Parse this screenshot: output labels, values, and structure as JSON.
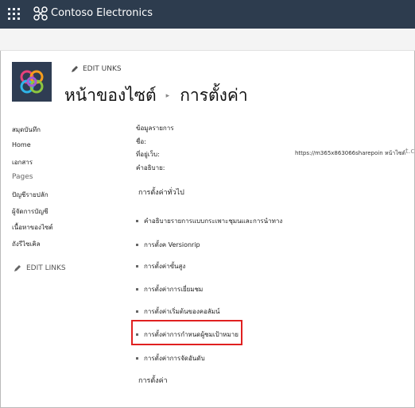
{
  "suite": {
    "app_name": "Contoso Electronics"
  },
  "header": {
    "edit_links_label": "EDIT UNKS",
    "breadcrumb_parent": "หน้าของไซต์",
    "breadcrumb_separator": "▸",
    "page_title": "การตั้งค่า"
  },
  "leftnav": {
    "items": [
      {
        "label": "สมุดบันทึก"
      },
      {
        "label": "Home"
      },
      {
        "label": "เอกสาร"
      },
      {
        "label": "Pages"
      },
      {
        "label": "ปัญชีรายปลัก"
      },
      {
        "label": "ผู้จัดการบัญชี"
      },
      {
        "label": "เนื้อหาของไซต์"
      },
      {
        "label": "ถังรีไซเคิล"
      }
    ],
    "edit_links_label": "EDIT LINKS"
  },
  "site_info": {
    "heading": "ข้อมูลรายการ",
    "name_label": "ชื่อ:",
    "address_label": "ที่อยู่เว็บ:",
    "address_value": "https://m365x863066sharepoin หน้าไซต์",
    "address_trail": "t.c",
    "description_label": "คำอธิบาย:"
  },
  "general_settings": {
    "heading": "การตั้งค่าทั่วไป",
    "items": [
      {
        "label": "คำอธิบายรายการแบบกระเพาะชุมนและการนำทาง"
      },
      {
        "label": "การตั้งค Versionrip"
      },
      {
        "label": "การตั้งค่าขั้นสูง"
      },
      {
        "label": "การตั้งค่าการเยี่ยมชม"
      },
      {
        "label": "การตั้งค่าเริ่มต้นของคอลัมน์"
      },
      {
        "label": "การตั้งค่าการกำหนดผู้ชมเป้าหมาย"
      },
      {
        "label": "การตั้งค่าการจัดอันดับ"
      }
    ],
    "footer_heading": "การตั้งค่า"
  },
  "colors": {
    "suite_bar": "#2d3c4e",
    "site_logo_bg": "#2f3d53",
    "highlight": "#e02020"
  },
  "icons": {
    "launcher": "waffle-icon",
    "brand": "contoso-logo-icon",
    "edit": "pencil-icon",
    "separator": "chevron-right-icon"
  }
}
